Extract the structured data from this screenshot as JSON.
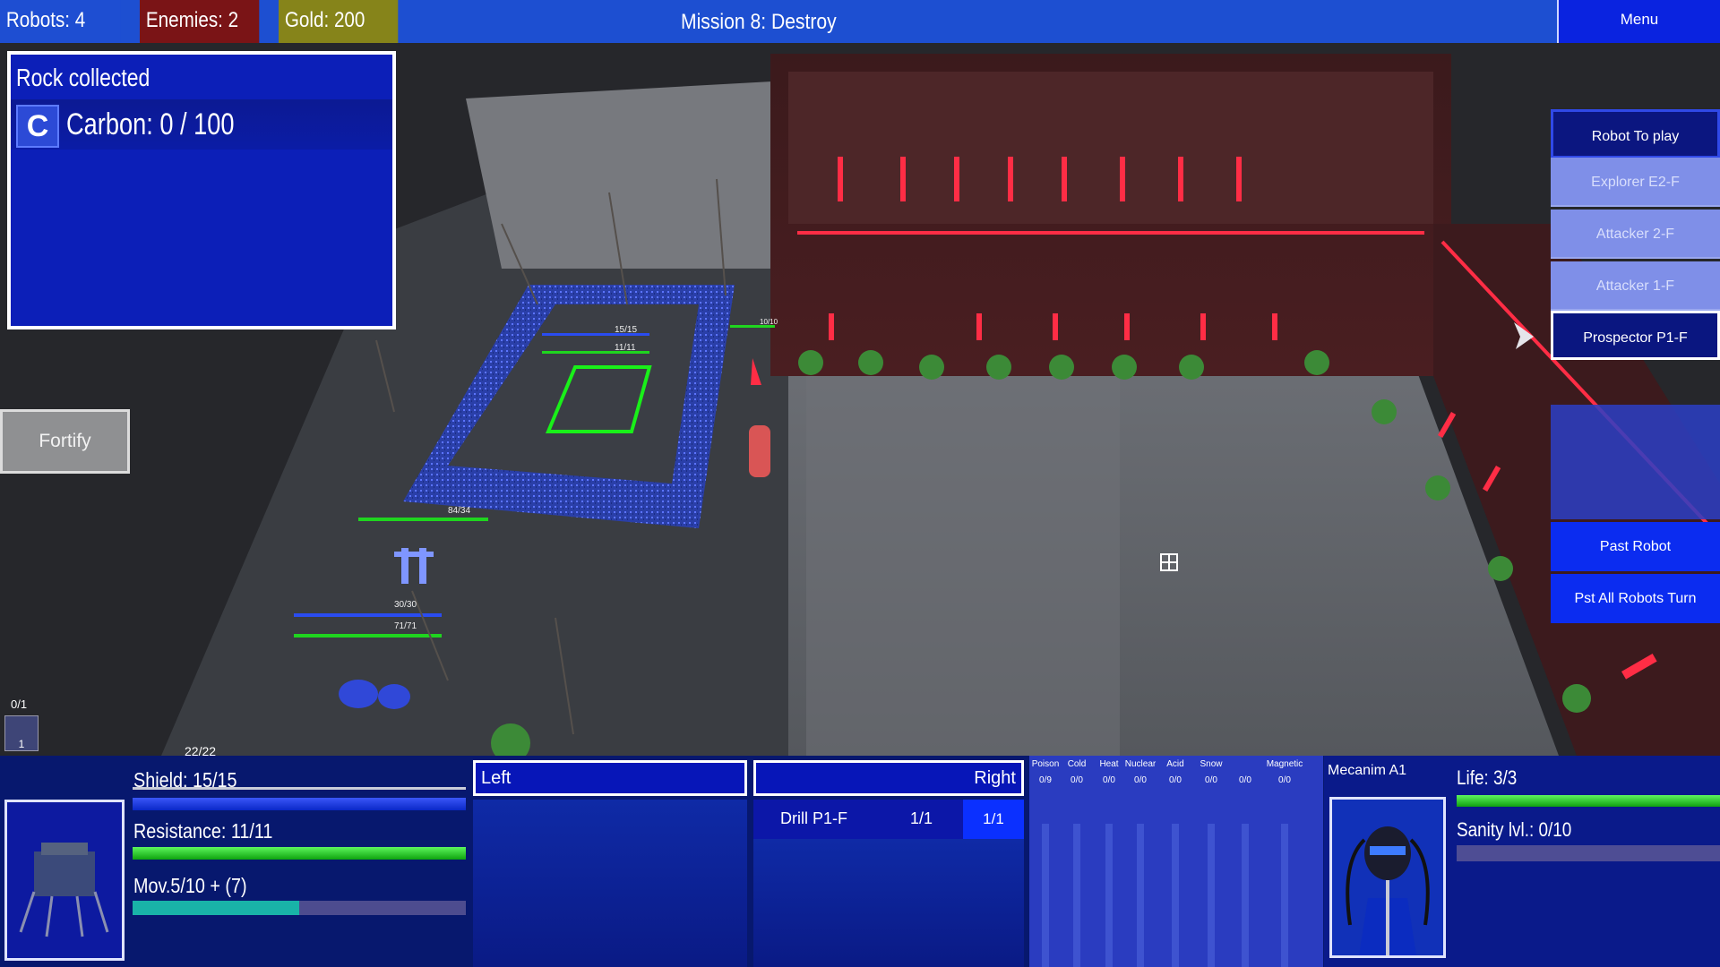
{
  "topbar": {
    "robots": "Robots: 4",
    "enemies": "Enemies: 2",
    "gold": "Gold: 200",
    "mission": "Mission 8: Destroy",
    "menu": "Menu"
  },
  "rock_panel": {
    "title": "Rock collected",
    "icon": "carbon-icon",
    "icon_glyph": "C",
    "carbon": "Carbon: 0 / 100"
  },
  "fortify": "Fortify",
  "right_panel": {
    "header": "Robot To play",
    "robots": [
      "Explorer E2-F",
      "Attacker 2-F",
      "Attacker 1-F"
    ],
    "selected": "Prospector P1-F",
    "past": "Past Robot",
    "past_all": "Pst All Robots Turn"
  },
  "scene_labels": {
    "hp1": "15/15",
    "hp2": "11/11",
    "hp3": "10/10",
    "hp4": "84/34",
    "hp5": "30/30",
    "hp6": "71/71",
    "hp7": "22/22",
    "counter": "0/1",
    "mini_num": "1"
  },
  "status": {
    "shield": "Shield: 15/15",
    "resistance": "Resistance: 11/11",
    "movement": "Mov.5/10 + (7)",
    "movement_fraction": 0.5
  },
  "arms": {
    "left": "Left",
    "right": "Right",
    "tool": "Drill P1-F",
    "tool_a": "1/1",
    "tool_b": "1/1"
  },
  "resistances": [
    {
      "name": "Poison",
      "value": "0/9"
    },
    {
      "name": "Cold",
      "value": "0/0"
    },
    {
      "name": "Heat",
      "value": "0/0"
    },
    {
      "name": "Nuclear",
      "value": "0/0"
    },
    {
      "name": "Acid",
      "value": "0/0"
    },
    {
      "name": "Snow",
      "value": "0/0"
    },
    {
      "name": "",
      "value": "0/0"
    },
    {
      "name": "Magnetic",
      "value": "0/0"
    }
  ],
  "pilot": {
    "name": "Mecanim A1",
    "life": "Life: 3/3",
    "sanity": "Sanity lvl.: 0/10"
  },
  "colors": {
    "topbar": "#1d4fd1",
    "enemies": "#7a1416",
    "gold": "#86841a",
    "panel": "#0c1fb8",
    "health_green": "#10a010",
    "shield_blue": "#0a28c8",
    "enemy_red": "#e8223a"
  }
}
